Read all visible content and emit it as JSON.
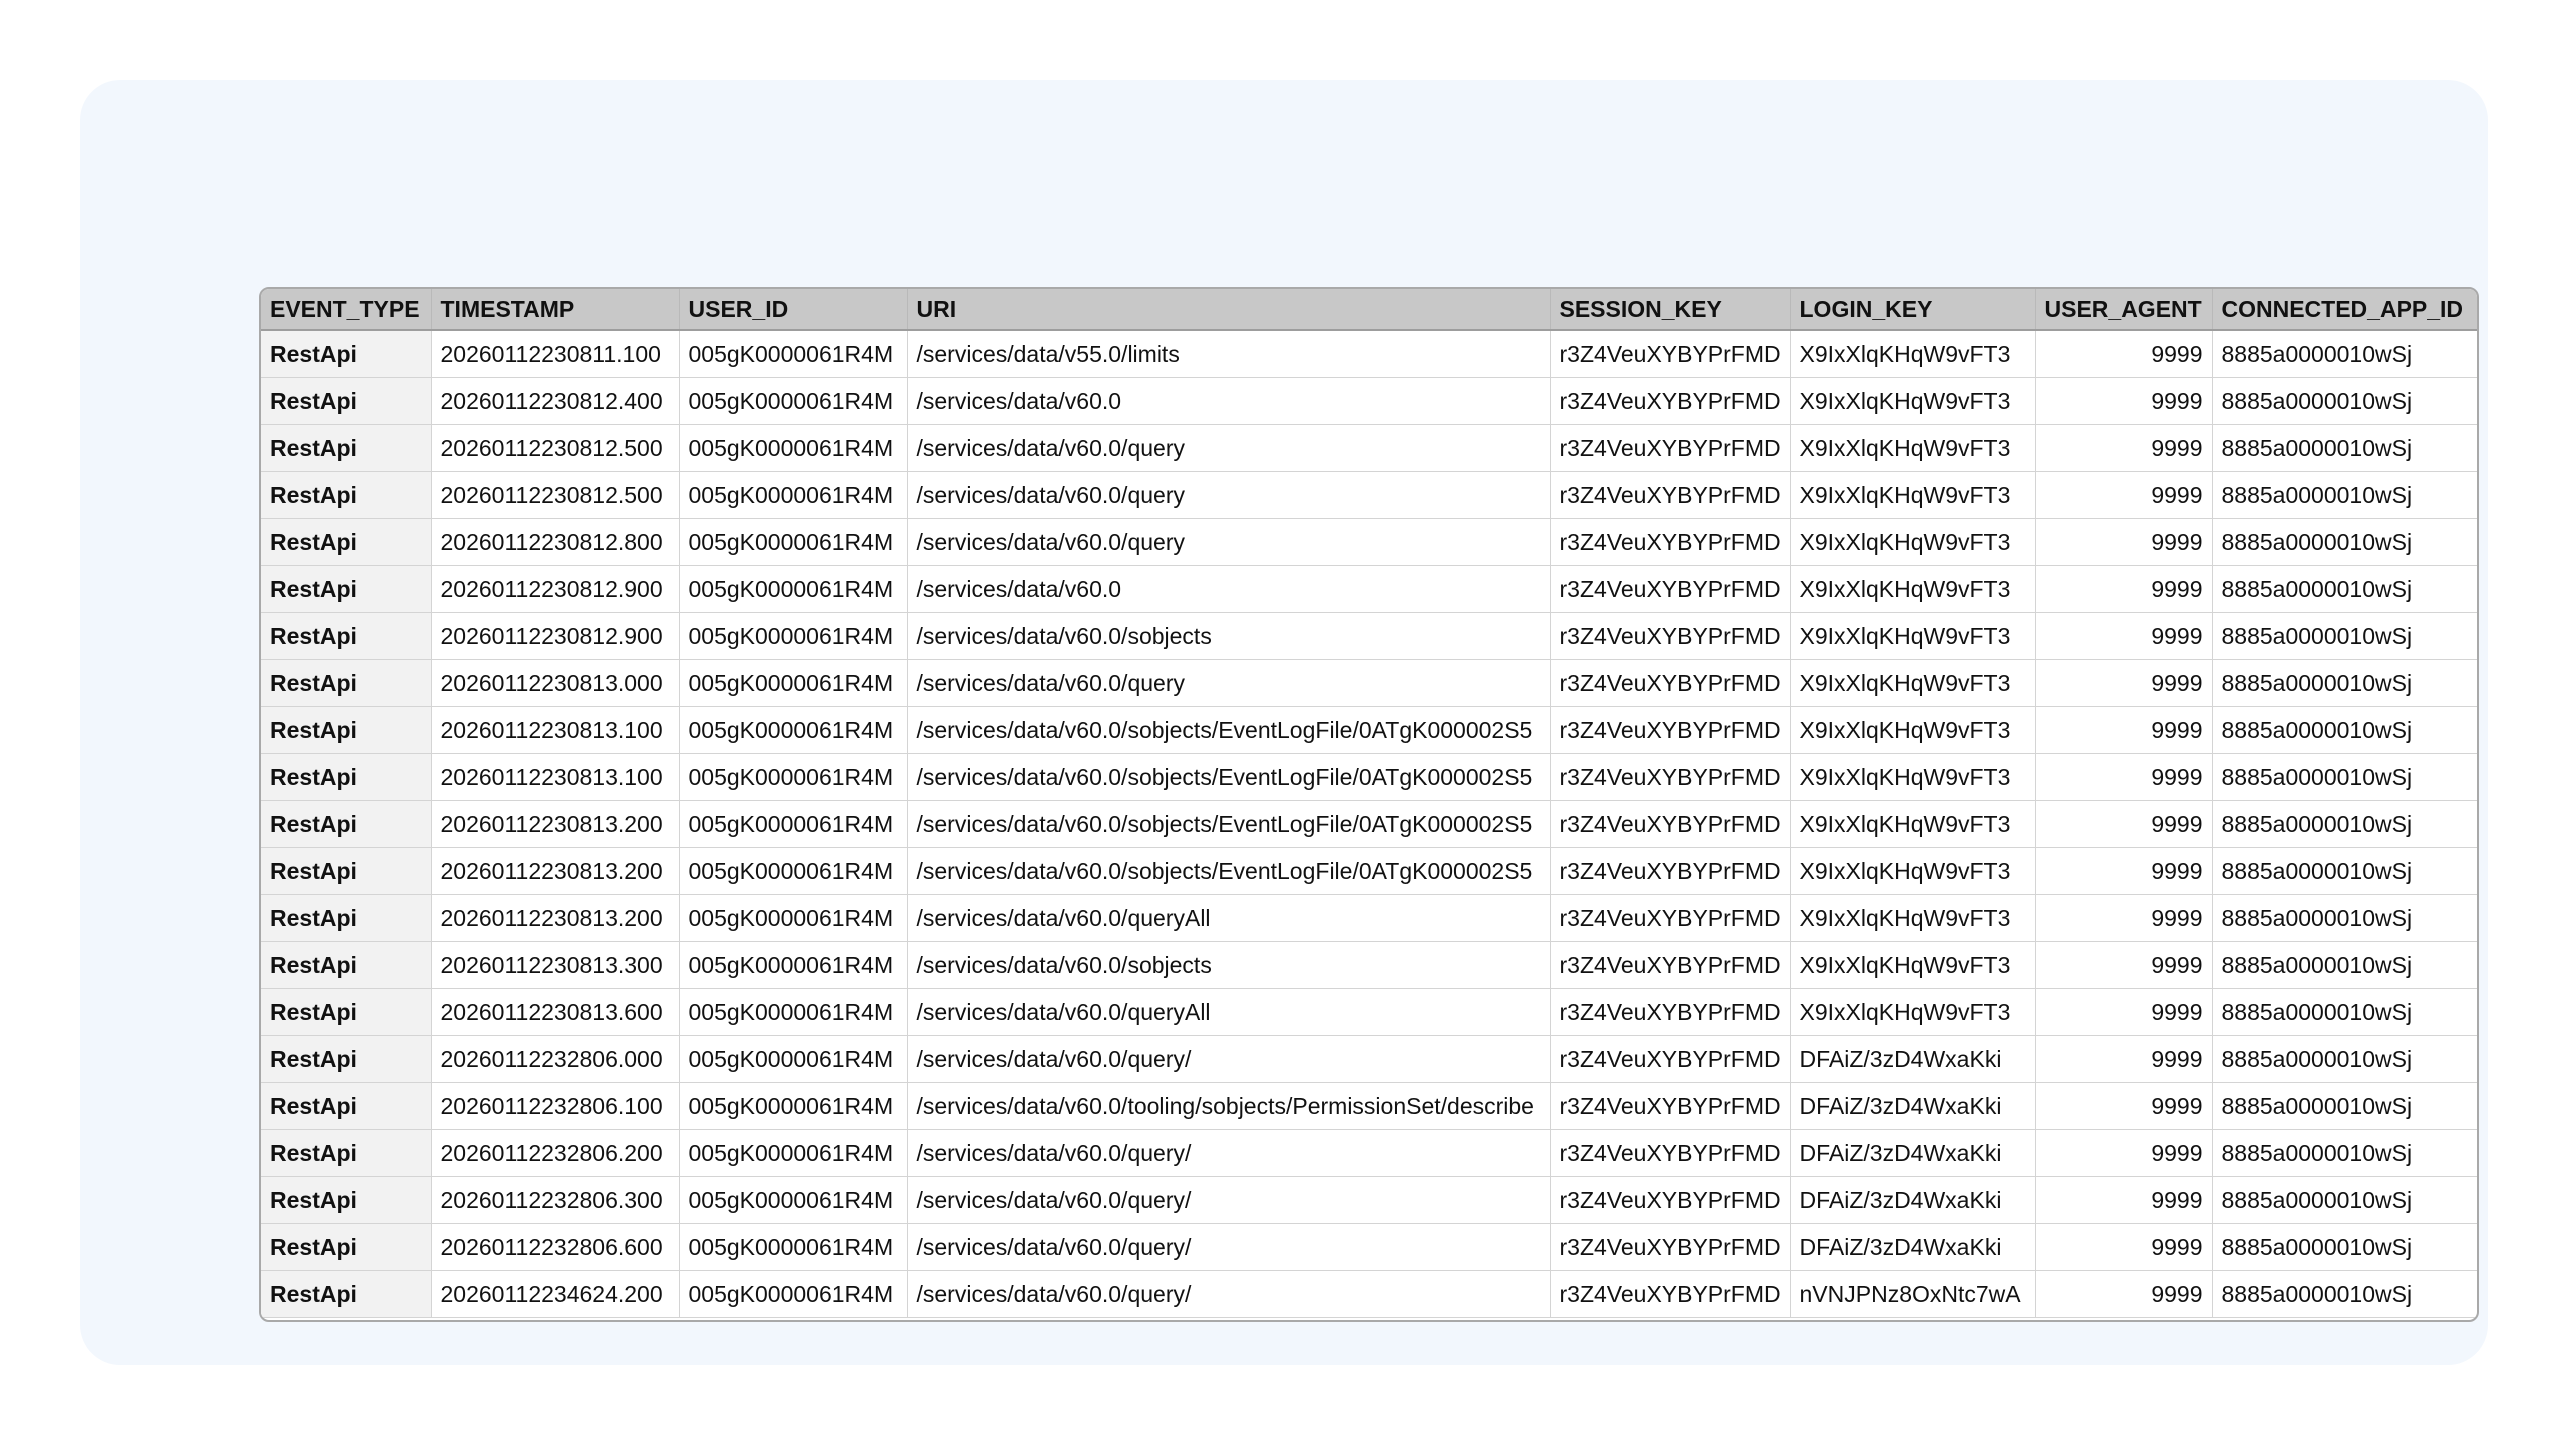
{
  "table": {
    "columns": [
      "EVENT_TYPE",
      "TIMESTAMP",
      "USER_ID",
      "URI",
      "SESSION_KEY",
      "LOGIN_KEY",
      "USER_AGENT",
      "CONNECTED_APP_ID"
    ],
    "rows": [
      [
        "RestApi",
        "20260112230811.100",
        "005gK0000061R4M",
        "/services/data/v55.0/limits",
        "r3Z4VeuXYBYPrFMD",
        "X9IxXlqKHqW9vFT3",
        "9999",
        "8885a0000010wSj"
      ],
      [
        "RestApi",
        "20260112230812.400",
        "005gK0000061R4M",
        "/services/data/v60.0",
        "r3Z4VeuXYBYPrFMD",
        "X9IxXlqKHqW9vFT3",
        "9999",
        "8885a0000010wSj"
      ],
      [
        "RestApi",
        "20260112230812.500",
        "005gK0000061R4M",
        "/services/data/v60.0/query",
        "r3Z4VeuXYBYPrFMD",
        "X9IxXlqKHqW9vFT3",
        "9999",
        "8885a0000010wSj"
      ],
      [
        "RestApi",
        "20260112230812.500",
        "005gK0000061R4M",
        "/services/data/v60.0/query",
        "r3Z4VeuXYBYPrFMD",
        "X9IxXlqKHqW9vFT3",
        "9999",
        "8885a0000010wSj"
      ],
      [
        "RestApi",
        "20260112230812.800",
        "005gK0000061R4M",
        "/services/data/v60.0/query",
        "r3Z4VeuXYBYPrFMD",
        "X9IxXlqKHqW9vFT3",
        "9999",
        "8885a0000010wSj"
      ],
      [
        "RestApi",
        "20260112230812.900",
        "005gK0000061R4M",
        "/services/data/v60.0",
        "r3Z4VeuXYBYPrFMD",
        "X9IxXlqKHqW9vFT3",
        "9999",
        "8885a0000010wSj"
      ],
      [
        "RestApi",
        "20260112230812.900",
        "005gK0000061R4M",
        "/services/data/v60.0/sobjects",
        "r3Z4VeuXYBYPrFMD",
        "X9IxXlqKHqW9vFT3",
        "9999",
        "8885a0000010wSj"
      ],
      [
        "RestApi",
        "20260112230813.000",
        "005gK0000061R4M",
        "/services/data/v60.0/query",
        "r3Z4VeuXYBYPrFMD",
        "X9IxXlqKHqW9vFT3",
        "9999",
        "8885a0000010wSj"
      ],
      [
        "RestApi",
        "20260112230813.100",
        "005gK0000061R4M",
        "/services/data/v60.0/sobjects/EventLogFile/0ATgK000002S5",
        "r3Z4VeuXYBYPrFMD",
        "X9IxXlqKHqW9vFT3",
        "9999",
        "8885a0000010wSj"
      ],
      [
        "RestApi",
        "20260112230813.100",
        "005gK0000061R4M",
        "/services/data/v60.0/sobjects/EventLogFile/0ATgK000002S5",
        "r3Z4VeuXYBYPrFMD",
        "X9IxXlqKHqW9vFT3",
        "9999",
        "8885a0000010wSj"
      ],
      [
        "RestApi",
        "20260112230813.200",
        "005gK0000061R4M",
        "/services/data/v60.0/sobjects/EventLogFile/0ATgK000002S5",
        "r3Z4VeuXYBYPrFMD",
        "X9IxXlqKHqW9vFT3",
        "9999",
        "8885a0000010wSj"
      ],
      [
        "RestApi",
        "20260112230813.200",
        "005gK0000061R4M",
        "/services/data/v60.0/sobjects/EventLogFile/0ATgK000002S5",
        "r3Z4VeuXYBYPrFMD",
        "X9IxXlqKHqW9vFT3",
        "9999",
        "8885a0000010wSj"
      ],
      [
        "RestApi",
        "20260112230813.200",
        "005gK0000061R4M",
        "/services/data/v60.0/queryAll",
        "r3Z4VeuXYBYPrFMD",
        "X9IxXlqKHqW9vFT3",
        "9999",
        "8885a0000010wSj"
      ],
      [
        "RestApi",
        "20260112230813.300",
        "005gK0000061R4M",
        "/services/data/v60.0/sobjects",
        "r3Z4VeuXYBYPrFMD",
        "X9IxXlqKHqW9vFT3",
        "9999",
        "8885a0000010wSj"
      ],
      [
        "RestApi",
        "20260112230813.600",
        "005gK0000061R4M",
        "/services/data/v60.0/queryAll",
        "r3Z4VeuXYBYPrFMD",
        "X9IxXlqKHqW9vFT3",
        "9999",
        "8885a0000010wSj"
      ],
      [
        "RestApi",
        "20260112232806.000",
        "005gK0000061R4M",
        "/services/data/v60.0/query/",
        "r3Z4VeuXYBYPrFMD",
        "DFAiZ/3zD4WxaKki",
        "9999",
        "8885a0000010wSj"
      ],
      [
        "RestApi",
        "20260112232806.100",
        "005gK0000061R4M",
        "/services/data/v60.0/tooling/sobjects/PermissionSet/describe",
        "r3Z4VeuXYBYPrFMD",
        "DFAiZ/3zD4WxaKki",
        "9999",
        "8885a0000010wSj"
      ],
      [
        "RestApi",
        "20260112232806.200",
        "005gK0000061R4M",
        "/services/data/v60.0/query/",
        "r3Z4VeuXYBYPrFMD",
        "DFAiZ/3zD4WxaKki",
        "9999",
        "8885a0000010wSj"
      ],
      [
        "RestApi",
        "20260112232806.300",
        "005gK0000061R4M",
        "/services/data/v60.0/query/",
        "r3Z4VeuXYBYPrFMD",
        "DFAiZ/3zD4WxaKki",
        "9999",
        "8885a0000010wSj"
      ],
      [
        "RestApi",
        "20260112232806.600",
        "005gK0000061R4M",
        "/services/data/v60.0/query/",
        "r3Z4VeuXYBYPrFMD",
        "DFAiZ/3zD4WxaKki",
        "9999",
        "8885a0000010wSj"
      ],
      [
        "RestApi",
        "20260112234624.200",
        "005gK0000061R4M",
        "/services/data/v60.0/query/",
        "r3Z4VeuXYBYPrFMD",
        "nVNJPNz8OxNtc7wA",
        "9999",
        "8885a0000010wSj"
      ]
    ]
  }
}
